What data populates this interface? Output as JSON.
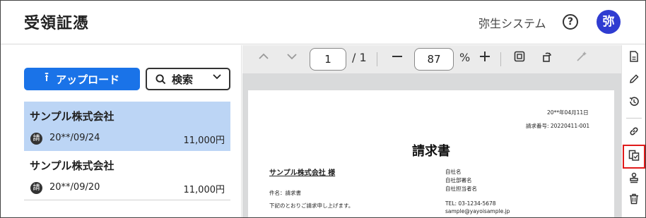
{
  "header": {
    "title": "受領証憑",
    "company": "弥生システム",
    "help_glyph": "?",
    "avatar_label": "弥"
  },
  "left_panel": {
    "upload_label": "アップロード",
    "search_label": "検索",
    "items": [
      {
        "name": "サンプル株式会社",
        "badge": "請",
        "date": "20**/09/24",
        "amount": "11,000円",
        "selected": true
      },
      {
        "name": "サンプル株式会社",
        "badge": "請",
        "date": "20**/09/20",
        "amount": "11,000円",
        "selected": false
      }
    ]
  },
  "viewer": {
    "page_current": "1",
    "page_total": "/ 1",
    "zoom": "87",
    "zoom_unit": "%",
    "document": {
      "date": "20**年04月11日",
      "invoice_no": "請求番号: 20220411-001",
      "title": "請求書",
      "recipient": "サンプル株式会社 様",
      "subject": "件名：請求書",
      "message": "下記のとおりご請求申し上げます。",
      "sender_name": "自社名",
      "sender_dept": "自社部署名",
      "sender_person": "自社担当者名",
      "tel": "TEL: 03-1234-5678",
      "email": "sample@yayoisample.jp"
    }
  },
  "rail": {
    "icons": [
      "document-icon",
      "pencil-icon",
      "history-icon",
      "link-icon",
      "copy-document-icon",
      "stamp-icon",
      "trash-icon"
    ],
    "highlighted": "copy-document-icon",
    "highlight_color": "#e01b1b"
  },
  "colors": {
    "accent": "#1a73e8",
    "selected_row": "#bcd5f5",
    "avatar": "#2f3cd1"
  }
}
